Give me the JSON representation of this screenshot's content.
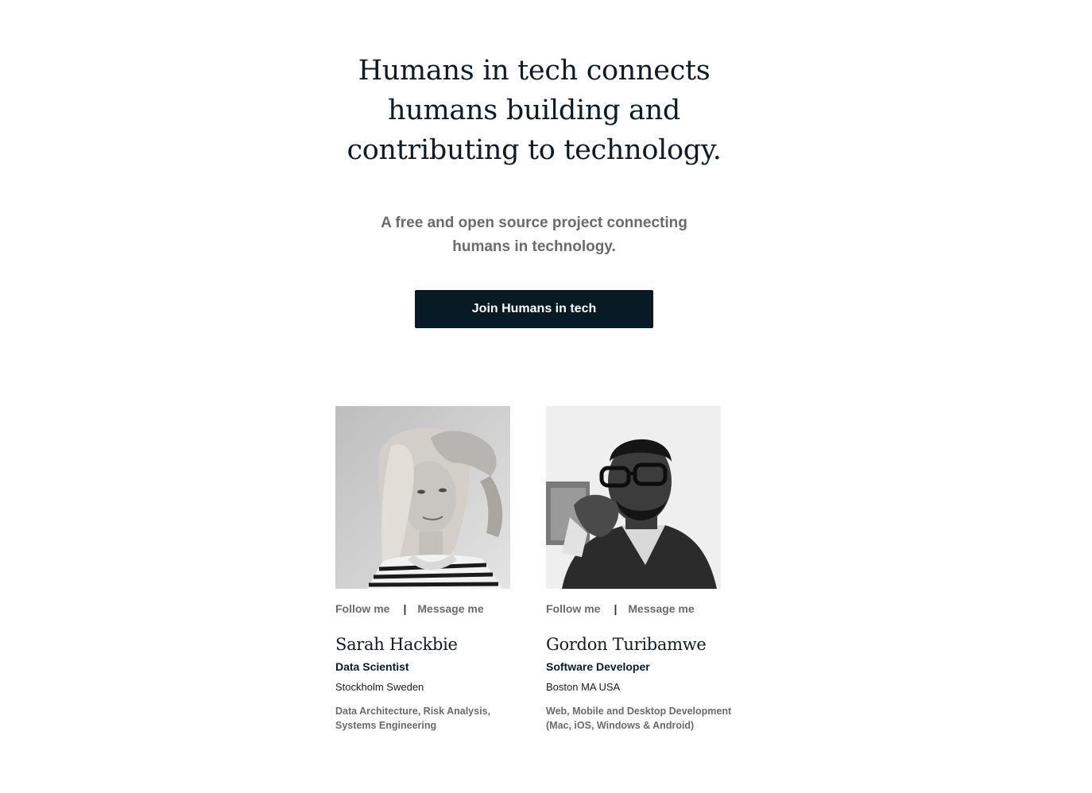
{
  "hero": {
    "title": "Humans in tech connects humans building and contributing to technology.",
    "subtitle": "A free and open source project connecting humans in technology.",
    "join_label": "Join Humans in tech"
  },
  "people": [
    {
      "follow_label": "Follow me",
      "separator": "|",
      "message_label": "Message me",
      "name": "Sarah Hackbie",
      "role": "Data Scientist",
      "location": "Stockholm Sweden",
      "skills": "Data Architecture, Risk Analysis, Systems Engineering"
    },
    {
      "follow_label": "Follow me",
      "separator": "|",
      "message_label": "Message me",
      "name": "Gordon Turibamwe",
      "role": "Software Developer",
      "location": "Boston MA USA",
      "skills": "Web, Mobile and Desktop Development (Mac, iOS, Windows & Android)"
    }
  ],
  "colors": {
    "primary": "#081a26",
    "muted_text": "#6b6b6b"
  }
}
